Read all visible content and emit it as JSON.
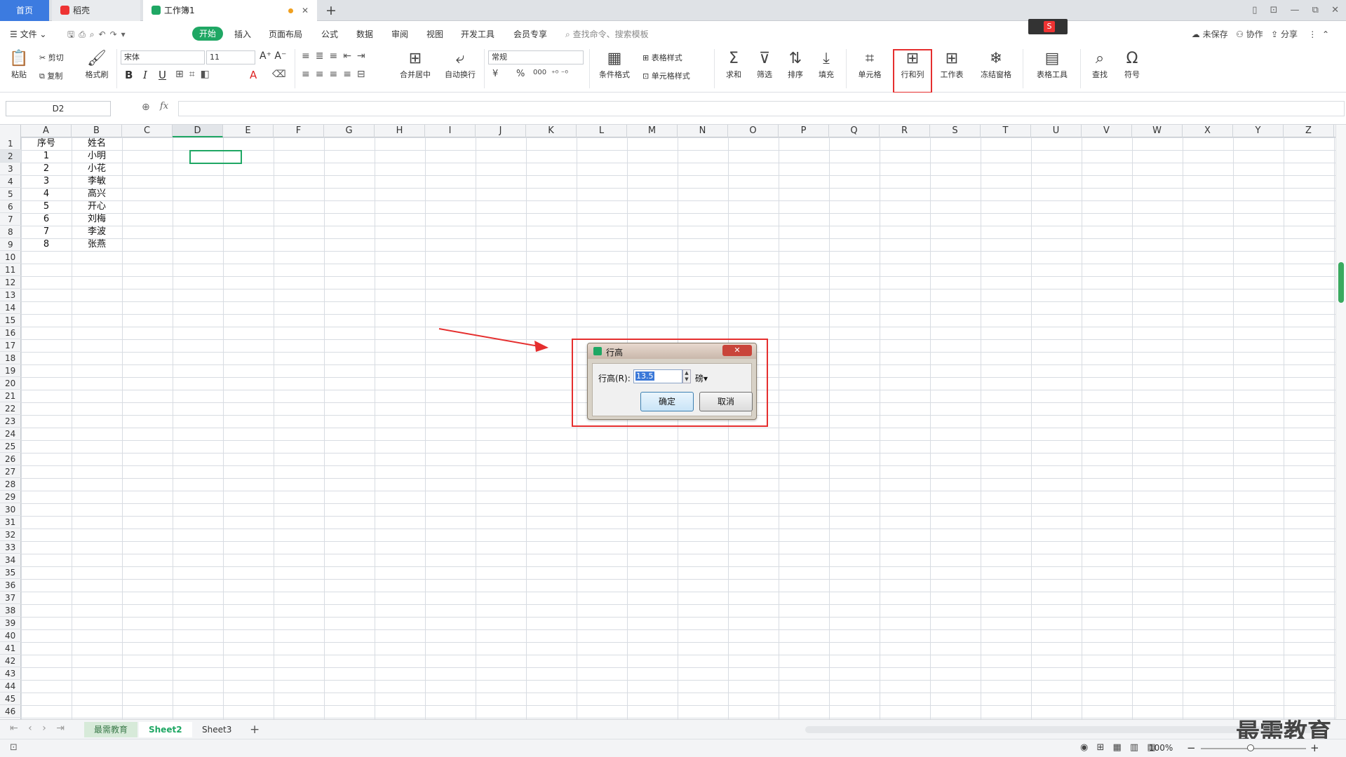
{
  "tabs": {
    "home": "首页",
    "daoke": "稻壳",
    "workbook": "工作簿1",
    "new_tab": "+"
  },
  "window_controls": "▯ ⊡ — ⧉ ✕",
  "menu": {
    "file": "文件",
    "start": "开始",
    "insert": "插入",
    "layout": "页面布局",
    "formula": "公式",
    "data": "数据",
    "review": "审阅",
    "view": "视图",
    "dev": "开发工具",
    "vip": "会员专享",
    "search": "查找命令、搜索模板",
    "unsaved": "未保存",
    "collab": "协作",
    "share": "分享"
  },
  "ribbon": {
    "paste": "粘贴",
    "cut": "剪切",
    "copy": "复制",
    "format_painter": "格式刷",
    "font_name": "宋体",
    "font_size": "11",
    "number_format": "常规",
    "merge_center": "合并居中",
    "wrap_text": "自动换行",
    "cond_format": "条件格式",
    "table_style": "表格样式",
    "cell_style": "单元格样式",
    "sum": "求和",
    "filter": "筛选",
    "sort": "排序",
    "fill": "填充",
    "cell": "单元格",
    "row_col": "行和列",
    "worksheet": "工作表",
    "freeze": "冻结窗格",
    "table_tools": "表格工具",
    "find": "查找",
    "symbol": "符号",
    "bold": "B",
    "italic": "I",
    "underline": "U",
    "currency": "¥",
    "percent": "%",
    "thousand": "000"
  },
  "formula_bar": {
    "name_box": "D2",
    "fx": "fx"
  },
  "columns": [
    "A",
    "B",
    "C",
    "D",
    "E",
    "F",
    "G",
    "H",
    "I",
    "J",
    "K",
    "L",
    "M",
    "N",
    "O",
    "P",
    "Q",
    "R",
    "S",
    "T",
    "U",
    "V",
    "W",
    "X",
    "Y",
    "Z"
  ],
  "rows": [
    "1",
    "2",
    "3",
    "4",
    "5",
    "6",
    "7",
    "8",
    "9",
    "10",
    "11",
    "12",
    "13",
    "14",
    "15",
    "16",
    "17",
    "18",
    "19",
    "20",
    "21",
    "22",
    "23",
    "24",
    "25",
    "26",
    "27",
    "28",
    "29",
    "30",
    "31",
    "32",
    "33",
    "34",
    "35",
    "36",
    "37",
    "38",
    "39",
    "40",
    "41",
    "42",
    "43",
    "44",
    "45",
    "46"
  ],
  "sheet_data": [
    [
      "序号",
      "姓名"
    ],
    [
      "1",
      "小明"
    ],
    [
      "2",
      "小花"
    ],
    [
      "3",
      "李敏"
    ],
    [
      "4",
      "高兴"
    ],
    [
      "5",
      "开心"
    ],
    [
      "6",
      "刘梅"
    ],
    [
      "7",
      "李波"
    ],
    [
      "8",
      "张燕"
    ]
  ],
  "sheets": [
    "最需教育",
    "Sheet2",
    "Sheet3"
  ],
  "watermark": "最需教育",
  "status": {
    "zoom": "100%"
  },
  "dialog": {
    "title": "行高",
    "label": "行高(R):",
    "value": "13.5",
    "unit": "磅",
    "ok": "确定",
    "cancel": "取消",
    "close": "✕"
  },
  "colors": {
    "accent": "#1fa764",
    "highlight": "#e52e2e",
    "tab_blue": "#3c7be0"
  }
}
